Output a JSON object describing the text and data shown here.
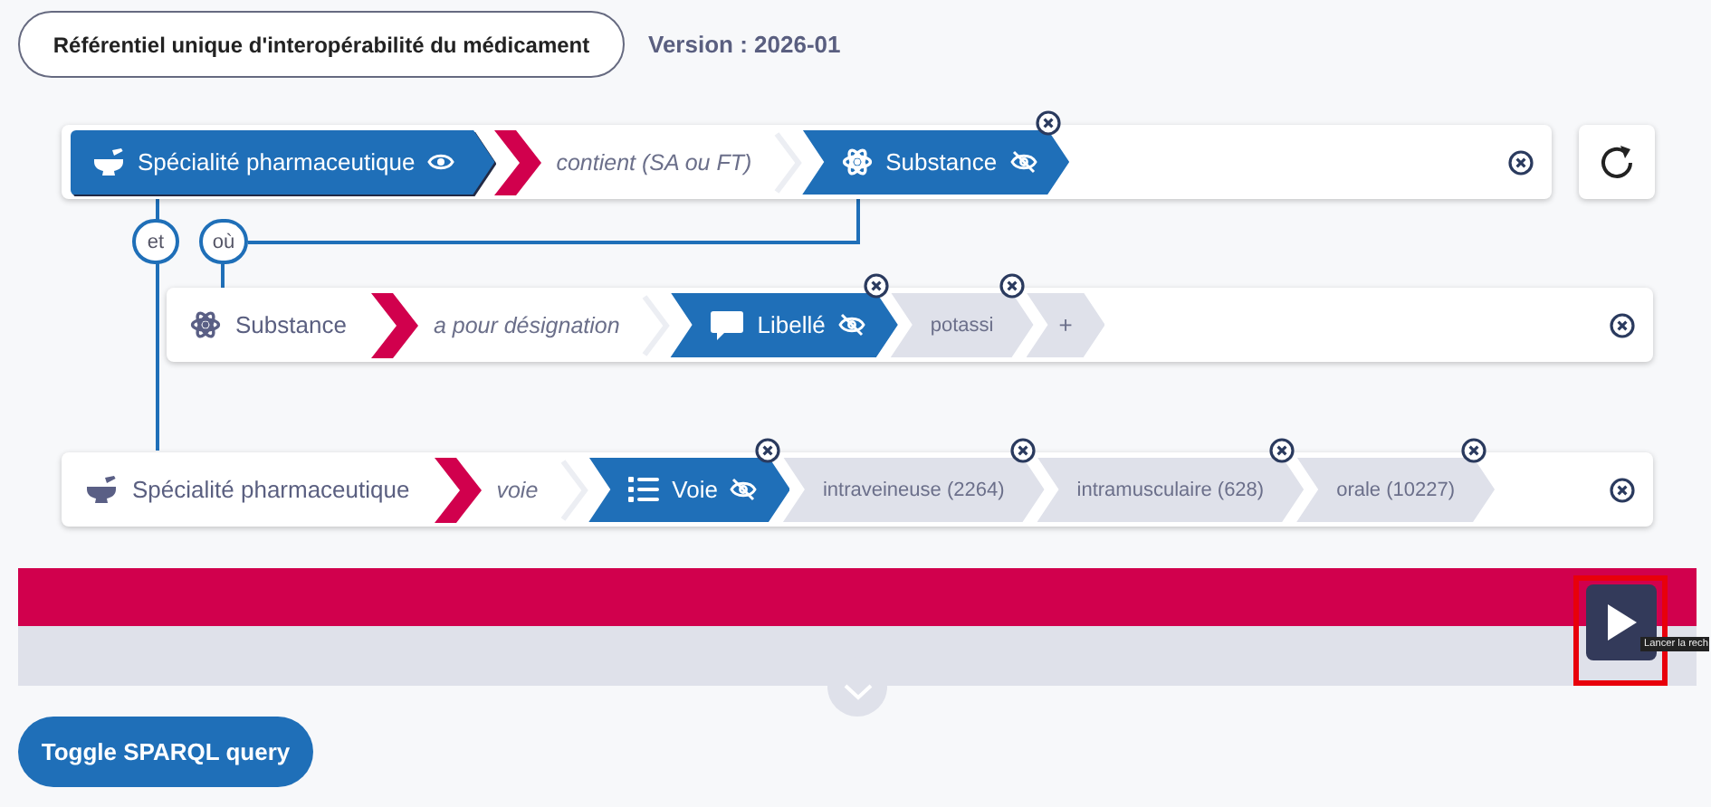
{
  "header": {
    "title": "Référentiel unique d'interopérabilité du médicament",
    "version": "Version : 2026-01"
  },
  "rows": [
    {
      "subject": {
        "label": "Spécialité pharmaceutique",
        "selected": true,
        "visible": true
      },
      "predicate": "contient (SA ou FT)",
      "object": {
        "label": "Substance",
        "visible": false
      },
      "values": []
    },
    {
      "subject": {
        "label": "Substance",
        "selected": false
      },
      "predicate": "a pour désignation",
      "object": {
        "label": "Libellé",
        "visible": false
      },
      "values": [
        {
          "kind": "value",
          "label": "potassi"
        },
        {
          "kind": "add",
          "label": "+"
        }
      ]
    },
    {
      "subject": {
        "label": "Spécialité pharmaceutique",
        "selected": false
      },
      "predicate": "voie",
      "object": {
        "label": "Voie",
        "visible": false
      },
      "values": [
        {
          "kind": "value",
          "label": "intraveineuse (2264)"
        },
        {
          "kind": "value",
          "label": "intramusculaire (628)"
        },
        {
          "kind": "value",
          "label": "orale (10227)"
        }
      ]
    }
  ],
  "connectors": [
    {
      "label": "et"
    },
    {
      "label": "où"
    }
  ],
  "tooltip": "Lancer la rech",
  "toggle_button": "Toggle SPARQL query"
}
